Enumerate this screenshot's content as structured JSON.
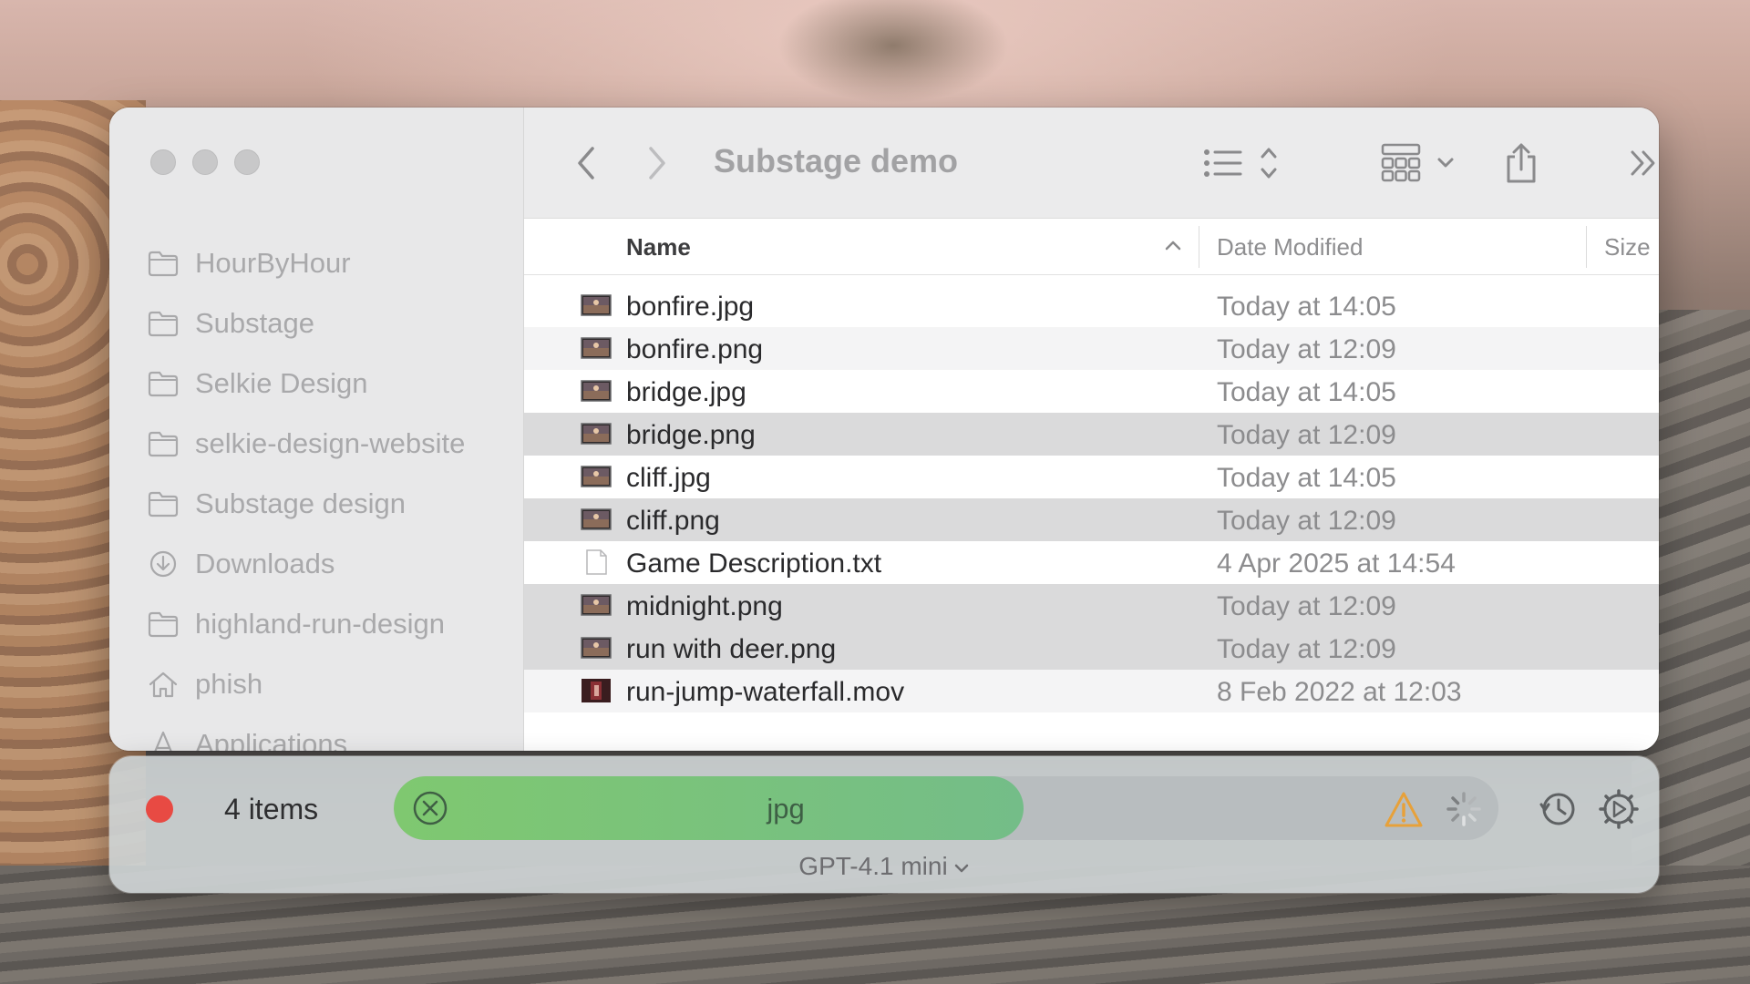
{
  "window": {
    "title": "Substage demo"
  },
  "sidebar": {
    "items": [
      {
        "label": "HourByHour",
        "icon": "folder-icon"
      },
      {
        "label": "Substage",
        "icon": "folder-icon"
      },
      {
        "label": "Selkie Design",
        "icon": "folder-icon"
      },
      {
        "label": "selkie-design-website",
        "icon": "folder-icon"
      },
      {
        "label": "Substage design",
        "icon": "folder-icon"
      },
      {
        "label": "Downloads",
        "icon": "download-icon"
      },
      {
        "label": "highland-run-design",
        "icon": "folder-icon"
      },
      {
        "label": "phish",
        "icon": "home-icon"
      },
      {
        "label": "Applications",
        "icon": "applications-icon"
      }
    ]
  },
  "columns": {
    "name": "Name",
    "date": "Date Modified",
    "size": "Size"
  },
  "files": [
    {
      "name": "bonfire.jpg",
      "date": "Today at 14:05",
      "thumb": "image-thumb-icon",
      "state": "normal"
    },
    {
      "name": "bonfire.png",
      "date": "Today at 12:09",
      "thumb": "image-thumb-icon",
      "state": "alt"
    },
    {
      "name": "bridge.jpg",
      "date": "Today at 14:05",
      "thumb": "image-thumb-icon",
      "state": "normal"
    },
    {
      "name": "bridge.png",
      "date": "Today at 12:09",
      "thumb": "image-thumb-icon",
      "state": "selected"
    },
    {
      "name": "cliff.jpg",
      "date": "Today at 14:05",
      "thumb": "image-thumb-icon",
      "state": "normal"
    },
    {
      "name": "cliff.png",
      "date": "Today at 12:09",
      "thumb": "image-thumb-icon",
      "state": "selected"
    },
    {
      "name": "Game Description.txt",
      "date": "4 Apr 2025 at 14:54",
      "thumb": "text-document-icon",
      "state": "normal"
    },
    {
      "name": "midnight.png",
      "date": "Today at 12:09",
      "thumb": "image-thumb-icon",
      "state": "selected"
    },
    {
      "name": "run with deer.png",
      "date": "Today at 12:09",
      "thumb": "image-thumb-icon",
      "state": "selected"
    },
    {
      "name": "run-jump-waterfall.mov",
      "date": "8 Feb 2022 at 12:03",
      "thumb": "video-thumb-icon",
      "state": "alt"
    }
  ],
  "substage": {
    "items_count": "4 items",
    "prompt_text": "jpg",
    "prompt_progress": 0.57,
    "model": "GPT-4.1 mini",
    "colors": {
      "record": "#e84a43",
      "progress_start": "#7fc870",
      "progress_end": "#74bd88",
      "warning": "#e7a13a"
    }
  }
}
